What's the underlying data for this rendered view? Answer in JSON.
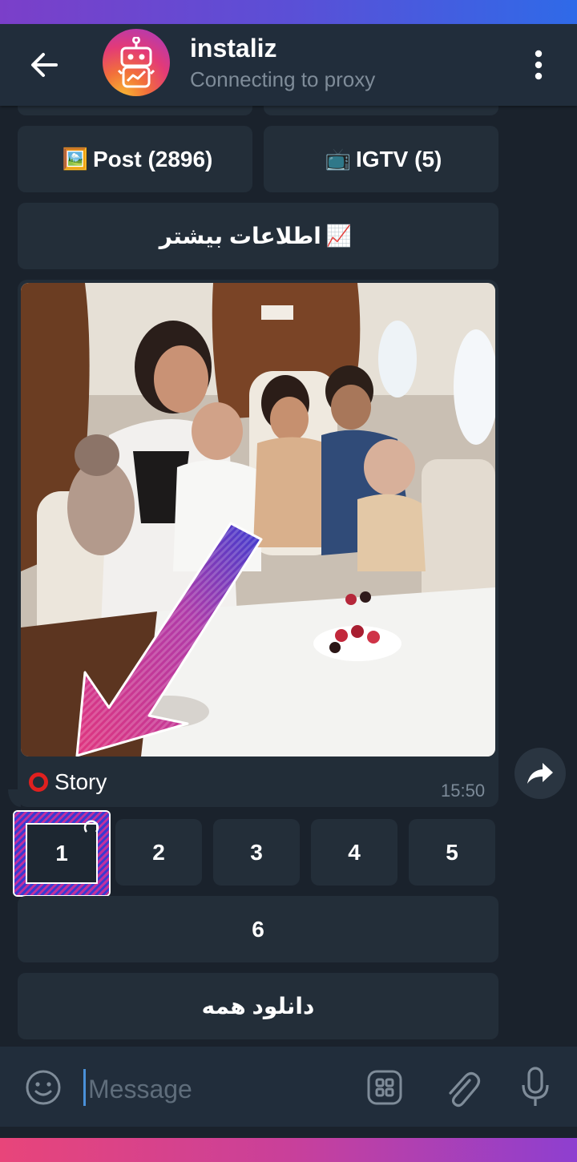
{
  "header": {
    "title": "instaliz",
    "status": "Connecting to proxy"
  },
  "keyboard_top": [
    {
      "emoji": "🖼️",
      "label": "Post (2896)"
    },
    {
      "emoji": "📺",
      "label": "IGTV (5)"
    }
  ],
  "more_info": {
    "emoji": "📈",
    "label": "اطلاعات بیشتر"
  },
  "message": {
    "caption_icon": "red-circle",
    "caption": "Story",
    "time": "15:50",
    "photo_icon": "photo"
  },
  "story_buttons": [
    "1",
    "2",
    "3",
    "4",
    "5"
  ],
  "story_button_6": "6",
  "download_all": "دانلود همه",
  "composer": {
    "placeholder": "Message"
  },
  "colors": {
    "accent": "#4a90d9",
    "background": "#1a222c",
    "header": "#212d3b",
    "button": "#232e39",
    "highlight_pink": "#e0357e",
    "highlight_blue": "#3b3ad0"
  }
}
